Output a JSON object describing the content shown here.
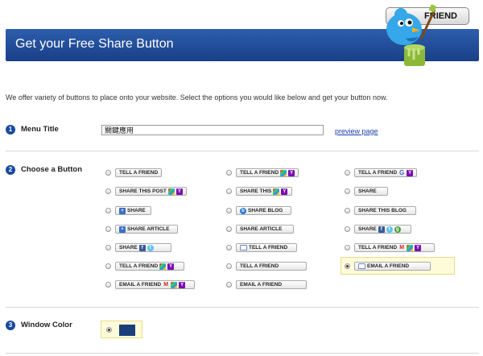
{
  "header": {
    "title": "Get your Free Share Button",
    "top_button_label": "FRIEND"
  },
  "intro": "We offer variety of buttons to place onto your website. Select the options you would like below and get your button now.",
  "sections": [
    {
      "num": "1",
      "title": "Menu Title"
    },
    {
      "num": "2",
      "title": "Choose a Button"
    },
    {
      "num": "3",
      "title": "Window Color"
    }
  ],
  "menu_title": {
    "value": "關鍵應用",
    "preview_link": "preview page"
  },
  "buttons": [
    {
      "label": "TELL A FRIEND",
      "icons": [],
      "selected": false
    },
    {
      "label": "TELL A FRIEND",
      "icons": [
        "msn",
        "yahoo"
      ],
      "selected": false
    },
    {
      "label": "TELL A FRIEND",
      "icons": [
        "google",
        "yahoo"
      ],
      "selected": false
    },
    {
      "label": "SHARE THIS POST",
      "icons": [
        "msn",
        "yahoo"
      ],
      "selected": false
    },
    {
      "label": "SHARE THIS",
      "icons": [
        "msn",
        "yahoo"
      ],
      "selected": false
    },
    {
      "label": "SHARE",
      "icons": [],
      "selected": false
    },
    {
      "label": "SHARE",
      "icons": [
        "plus"
      ],
      "selected": false
    },
    {
      "label": "SHARE BLOG",
      "icons": [
        "blog"
      ],
      "selected": false
    },
    {
      "label": "SHARE THIS BLOG",
      "icons": [],
      "selected": false
    },
    {
      "label": "SHARE ARTICLE",
      "icons": [
        "plus"
      ],
      "selected": false
    },
    {
      "label": "SHARE ARTICLE",
      "icons": [],
      "selected": false
    },
    {
      "label": "SHARE",
      "icons": [
        "facebook",
        "twitter",
        "green"
      ],
      "selected": false
    },
    {
      "label": "SHARE",
      "icons": [
        "facebook",
        "twitter"
      ],
      "selected": false
    },
    {
      "label": "TELL A FRIEND",
      "icons": [
        "mail"
      ],
      "selected": false
    },
    {
      "label": "TELL A FRIEND",
      "icons": [
        "gmail",
        "msn",
        "yahoo"
      ],
      "selected": false
    },
    {
      "label": "TELL A FRIEND",
      "icons": [
        "msn",
        "yahoo"
      ],
      "selected": false
    },
    {
      "label": "TELL A FRIEND",
      "icons": [],
      "selected": false
    },
    {
      "label": "EMAIL A FRIEND",
      "icons": [
        "mail"
      ],
      "selected": true
    },
    {
      "label": "EMAIL A FRIEND",
      "icons": [
        "gmail",
        "msn",
        "yahoo"
      ],
      "selected": false
    },
    {
      "label": "EMAIL A FRIEND",
      "icons": [],
      "selected": false
    }
  ],
  "window_color": {
    "value": "#1a3f7a",
    "selected": true
  }
}
